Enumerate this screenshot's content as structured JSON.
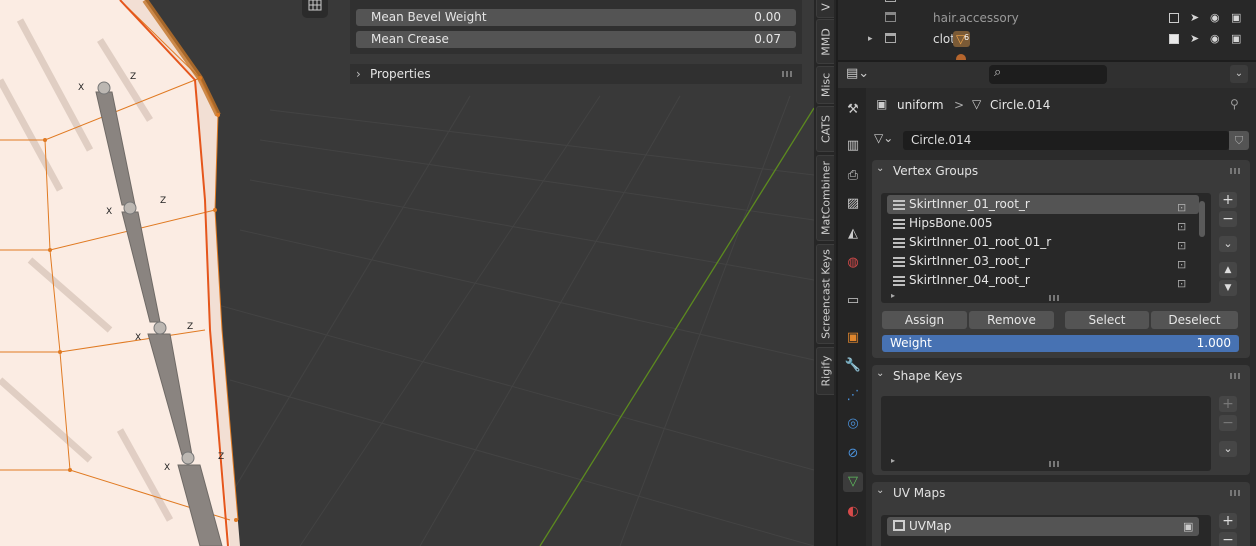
{
  "viewport": {
    "rows": [
      {
        "label": "Mean Bevel Weight",
        "value": "0.00"
      },
      {
        "label": "Mean Crease",
        "value": "0.07"
      }
    ],
    "properties_label": "Properties",
    "bone_labels": {
      "x": "X",
      "z": "Z"
    }
  },
  "n_panel_tabs": [
    "V",
    "MMD",
    "Misc",
    "CATS",
    "MatCombiner",
    "Screencast Keys",
    "Rigify"
  ],
  "outliner": {
    "rows": [
      {
        "name": "hair.accessory",
        "expand": "",
        "checked": false
      },
      {
        "name": "cloth",
        "expand": "▸",
        "checked": true,
        "badge": "6"
      }
    ]
  },
  "properties": {
    "breadcrumb": {
      "object": "uniform",
      "separator": ">",
      "data": "Circle.014"
    },
    "data_name": "Circle.014",
    "vertex_groups": {
      "title": "Vertex Groups",
      "items": [
        "SkirtInner_01_root_r",
        "HipsBone.005",
        "SkirtInner_01_root_01_r",
        "SkirtInner_03_root_r",
        "SkirtInner_04_root_r"
      ],
      "buttons": [
        "Assign",
        "Remove",
        "Select",
        "Deselect"
      ],
      "weight_label": "Weight",
      "weight_value": "1.000"
    },
    "shape_keys": {
      "title": "Shape Keys"
    },
    "uv_maps": {
      "title": "UV Maps",
      "items": [
        "UVMap"
      ]
    },
    "side_buttons": {
      "add": "+",
      "remove": "−",
      "menu": "⌄",
      "up": "▲",
      "down": "▼"
    }
  },
  "colors": {
    "accent": "#4772b3",
    "bone_orange": "#e07a22",
    "viewport_bg": "#393939"
  }
}
